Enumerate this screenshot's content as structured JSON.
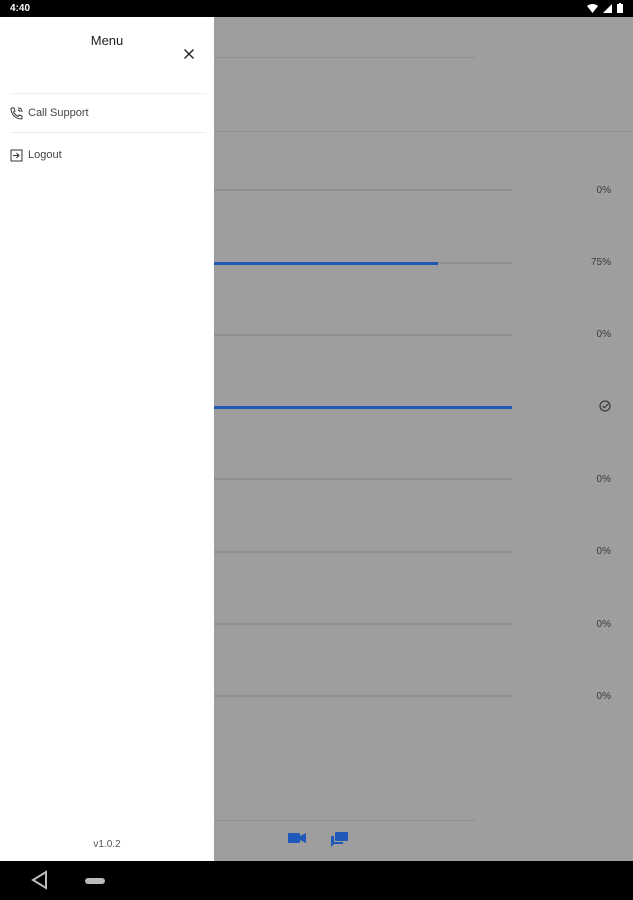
{
  "status_bar": {
    "time": "4:40"
  },
  "drawer": {
    "title": "Menu",
    "items": [
      {
        "label": "Call Support",
        "icon": "phone-call-icon"
      },
      {
        "label": "Logout",
        "icon": "logout-icon"
      }
    ],
    "version": "v1.0.2"
  },
  "progress_rows": [
    {
      "label": "0%",
      "progress": 0
    },
    {
      "label": "75%",
      "progress": 0.75
    },
    {
      "label": "0%",
      "progress": 0
    },
    {
      "label": "",
      "progress": 1.0,
      "complete": true
    },
    {
      "label": "0%",
      "progress": 0
    },
    {
      "label": "0%",
      "progress": 0
    },
    {
      "label": "0%",
      "progress": 0
    },
    {
      "label": "0%",
      "progress": 0
    }
  ],
  "colors": {
    "accent": "#1f58b9",
    "scrim": "#9e9e9e"
  },
  "bottom_actions": [
    {
      "icon": "video-camera-icon"
    },
    {
      "icon": "chat-icon"
    }
  ]
}
